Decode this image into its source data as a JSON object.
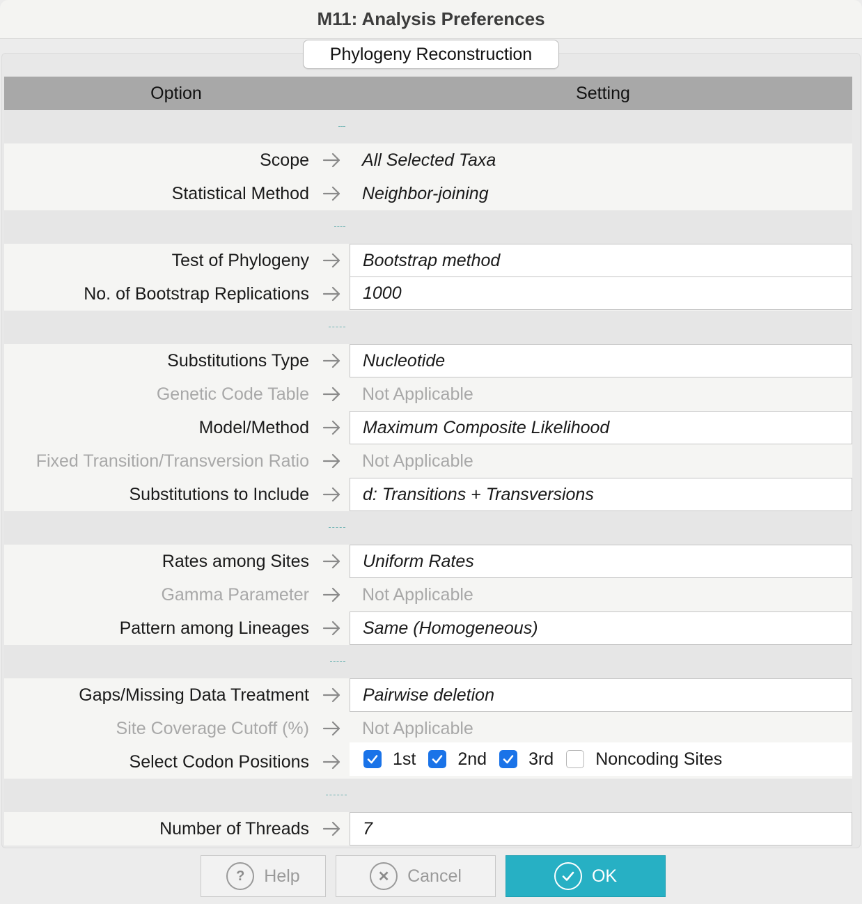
{
  "window": {
    "title": "M11: Analysis Preferences"
  },
  "tab": {
    "label": "Phylogeny Reconstruction"
  },
  "table": {
    "col_option": "Option",
    "col_setting": "Setting"
  },
  "rows": [
    {
      "label": "Scope",
      "value": "All Selected Taxa",
      "boxed": false,
      "enabled": true
    },
    {
      "label": "Statistical Method",
      "value": "Neighbor-joining",
      "boxed": false,
      "enabled": true
    },
    {
      "label": "Test of Phylogeny",
      "value": "Bootstrap method",
      "boxed": true,
      "enabled": true
    },
    {
      "label": "No. of Bootstrap Replications",
      "value": "1000",
      "boxed": true,
      "enabled": true
    },
    {
      "label": "Substitutions Type",
      "value": "Nucleotide",
      "boxed": true,
      "enabled": true
    },
    {
      "label": "Genetic Code Table",
      "value": "Not Applicable",
      "boxed": false,
      "enabled": false
    },
    {
      "label": "Model/Method",
      "value": "Maximum Composite Likelihood",
      "boxed": true,
      "enabled": true
    },
    {
      "label": "Fixed Transition/Transversion Ratio",
      "value": "Not Applicable",
      "boxed": false,
      "enabled": false
    },
    {
      "label": "Substitutions to Include",
      "value": "d: Transitions + Transversions",
      "boxed": true,
      "enabled": true
    },
    {
      "label": "Rates among Sites",
      "value": "Uniform Rates",
      "boxed": true,
      "enabled": true
    },
    {
      "label": "Gamma Parameter",
      "value": "Not Applicable",
      "boxed": false,
      "enabled": false
    },
    {
      "label": "Pattern among Lineages",
      "value": "Same (Homogeneous)",
      "boxed": true,
      "enabled": true
    },
    {
      "label": "Gaps/Missing Data Treatment",
      "value": "Pairwise deletion",
      "boxed": true,
      "enabled": true
    },
    {
      "label": "Site Coverage Cutoff (%)",
      "value": "Not Applicable",
      "boxed": false,
      "enabled": false
    },
    {
      "label": "Select Codon Positions",
      "value": "",
      "boxed": false,
      "enabled": true
    },
    {
      "label": "Number of Threads",
      "value": "7",
      "boxed": true,
      "enabled": true
    }
  ],
  "codon_positions": [
    {
      "label": "1st",
      "checked": true
    },
    {
      "label": "2nd",
      "checked": true
    },
    {
      "label": "3rd",
      "checked": true
    },
    {
      "label": "Noncoding Sites",
      "checked": false
    }
  ],
  "buttons": {
    "help": "Help",
    "cancel": "Cancel",
    "ok": "OK"
  },
  "colors": {
    "accent": "#27b0c4",
    "checkbox": "#1a73e8",
    "header": "#a8a8a8"
  }
}
